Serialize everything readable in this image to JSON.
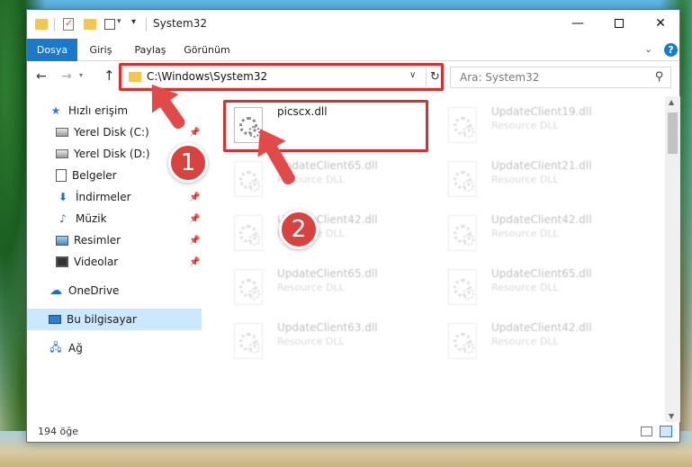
{
  "window": {
    "title": "System32",
    "minimize_glyph": "—",
    "close_glyph": "✕"
  },
  "ribbon": {
    "tabs": [
      "Dosya",
      "Giriş",
      "Paylaş",
      "Görünüm"
    ],
    "help_glyph": "?",
    "collapse_glyph": "⌄"
  },
  "navigation": {
    "back_glyph": "←",
    "forward_glyph": "→",
    "recent_glyph": "▾",
    "up_glyph": "↑",
    "address": "C:\\Windows\\System32",
    "address_dropdown_glyph": "∨",
    "refresh_glyph": "↻",
    "search_placeholder": "Ara: System32",
    "search_glyph": "⚲"
  },
  "sidebar": {
    "items": [
      {
        "label": "Hızlı erişim",
        "icon": "star-icon",
        "pinned": false
      },
      {
        "label": "Yerel Disk (C:)",
        "icon": "drive-icon",
        "pinned": true
      },
      {
        "label": "Yerel Disk (D:)",
        "icon": "drive-icon",
        "pinned": false
      },
      {
        "label": "Belgeler",
        "icon": "document-icon",
        "pinned": true
      },
      {
        "label": "İndirmeler",
        "icon": "download-icon",
        "pinned": true
      },
      {
        "label": "Müzik",
        "icon": "music-icon",
        "pinned": true
      },
      {
        "label": "Resimler",
        "icon": "pictures-icon",
        "pinned": true
      },
      {
        "label": "Videolar",
        "icon": "video-icon",
        "pinned": true
      },
      {
        "label": "OneDrive",
        "icon": "cloud-icon",
        "pinned": false
      },
      {
        "label": "Bu bilgisayar",
        "icon": "computer-icon",
        "pinned": false,
        "selected": true
      },
      {
        "label": "Ağ",
        "icon": "network-icon",
        "pinned": false
      }
    ],
    "pin_glyph": "📌"
  },
  "files": [
    {
      "name": "picscx.dll",
      "type": "",
      "faded": false,
      "highlighted": true
    },
    {
      "name": "UpdateClient19.dll",
      "type": "Resource DLL",
      "faded": true
    },
    {
      "name": "UpdateClient65.dll",
      "type": "Resource DLL",
      "faded": true
    },
    {
      "name": "UpdateClient21.dll",
      "type": "Resource DLL",
      "faded": true
    },
    {
      "name": "UpdateClient42.dll",
      "type": "Resource DLL",
      "faded": true
    },
    {
      "name": "UpdateClient42.dll",
      "type": "Resource DLL",
      "faded": true
    },
    {
      "name": "UpdateClient65.dll",
      "type": "Resource DLL",
      "faded": true
    },
    {
      "name": "UpdateClient65.dll",
      "type": "Resource DLL",
      "faded": true
    },
    {
      "name": "UpdateClient63.dll",
      "type": "Resource DLL",
      "faded": true
    },
    {
      "name": "UpdateClient42.dll",
      "type": "Resource DLL",
      "faded": true
    }
  ],
  "status": {
    "item_count": "194 öğe"
  },
  "annotations": {
    "step1": "1",
    "step2": "2",
    "color": "#d9433f"
  }
}
